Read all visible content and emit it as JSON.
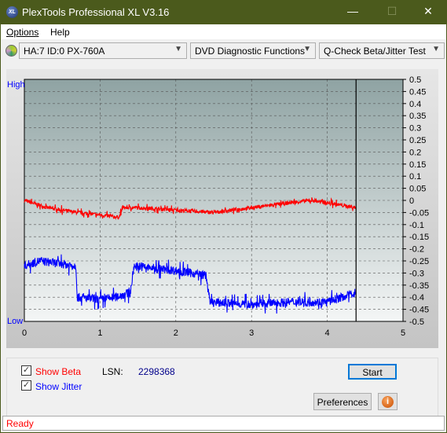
{
  "window": {
    "title": "PlexTools Professional XL V3.16",
    "logo": "XL",
    "minimize": "—",
    "maximize": "☐",
    "close": "✕"
  },
  "menu": {
    "options": "Options",
    "help": "Help"
  },
  "toolbar": {
    "drive": "HA:7 ID:0  PX-760A",
    "function": "DVD Diagnostic Functions",
    "test": "Q-Check Beta/Jitter Test",
    "drive_icon": "disc-icon"
  },
  "chart_data": {
    "type": "line",
    "left_labels": {
      "high": "High",
      "low": "Low"
    },
    "xlim": [
      0,
      5
    ],
    "ylim": [
      -0.5,
      0.5
    ],
    "x_ticks": [
      "0",
      "1",
      "2",
      "3",
      "4",
      "5"
    ],
    "y_ticks": [
      "0.5",
      "0.45",
      "0.4",
      "0.35",
      "0.3",
      "0.25",
      "0.2",
      "0.15",
      "0.1",
      "0.05",
      "0",
      "-0.05",
      "-0.1",
      "-0.15",
      "-0.2",
      "-0.25",
      "-0.3",
      "-0.35",
      "-0.4",
      "-0.45",
      "-0.5"
    ],
    "grid": true,
    "end_marker_x": 4.38,
    "series": [
      {
        "key": "beta",
        "color": "#ff0000",
        "points": [
          [
            0,
            0.0
          ],
          [
            0.3,
            -0.03
          ],
          [
            0.7,
            -0.05
          ],
          [
            1.0,
            -0.06
          ],
          [
            1.25,
            -0.07
          ],
          [
            1.3,
            -0.03
          ],
          [
            1.5,
            -0.03
          ],
          [
            2.0,
            -0.04
          ],
          [
            2.5,
            -0.05
          ],
          [
            3.0,
            -0.03
          ],
          [
            3.5,
            -0.01
          ],
          [
            3.8,
            0.0
          ],
          [
            4.0,
            -0.01
          ],
          [
            4.38,
            -0.03
          ]
        ]
      },
      {
        "key": "jitter",
        "color": "#0000ff",
        "points": [
          [
            0,
            -0.27
          ],
          [
            0.2,
            -0.25
          ],
          [
            0.68,
            -0.27
          ],
          [
            0.7,
            -0.4
          ],
          [
            1.0,
            -0.41
          ],
          [
            1.2,
            -0.4
          ],
          [
            1.4,
            -0.38
          ],
          [
            1.45,
            -0.27
          ],
          [
            1.7,
            -0.28
          ],
          [
            2.0,
            -0.29
          ],
          [
            2.4,
            -0.31
          ],
          [
            2.45,
            -0.42
          ],
          [
            3.0,
            -0.43
          ],
          [
            3.5,
            -0.42
          ],
          [
            4.0,
            -0.42
          ],
          [
            4.38,
            -0.38
          ]
        ]
      }
    ]
  },
  "controls": {
    "show_beta": "Show Beta",
    "show_jitter": "Show Jitter",
    "beta_checked": true,
    "jitter_checked": true,
    "lsn_label": "LSN:",
    "lsn_value": "2298368",
    "start": "Start",
    "preferences": "Preferences",
    "info_icon": "info-icon"
  },
  "status": "Ready"
}
